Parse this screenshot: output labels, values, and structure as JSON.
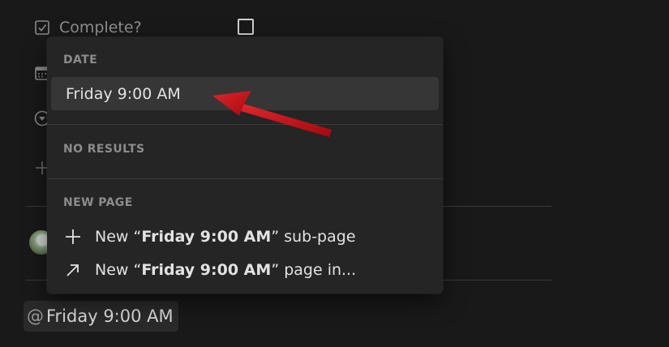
{
  "page": {
    "property_complete_label": "Complete?",
    "mention": {
      "at": "@",
      "text": "Friday 9:00 AM"
    }
  },
  "popup": {
    "date_section": "DATE",
    "date_option": "Friday 9:00 AM",
    "no_results_section": "NO RESULTS",
    "new_page_section": "NEW PAGE",
    "subpage_item": {
      "prefix": "New “",
      "name": "Friday 9:00 AM",
      "suffix": "” sub-page"
    },
    "page_in_item": {
      "prefix": "New “",
      "name": "Friday 9:00 AM",
      "suffix": "” page in..."
    }
  },
  "icons": {
    "checkbox_property": "checkbox-icon",
    "date_property": "calendar-icon",
    "select_property": "select-icon",
    "add_property": "plus-icon",
    "subpage": "plus-icon",
    "page_in": "arrow-up-right-icon",
    "annotation": "red-arrow-icon"
  },
  "colors": {
    "background": "#191919",
    "popup": "#252525",
    "highlight": "#363636",
    "annotation_arrow": "#c8161c"
  }
}
